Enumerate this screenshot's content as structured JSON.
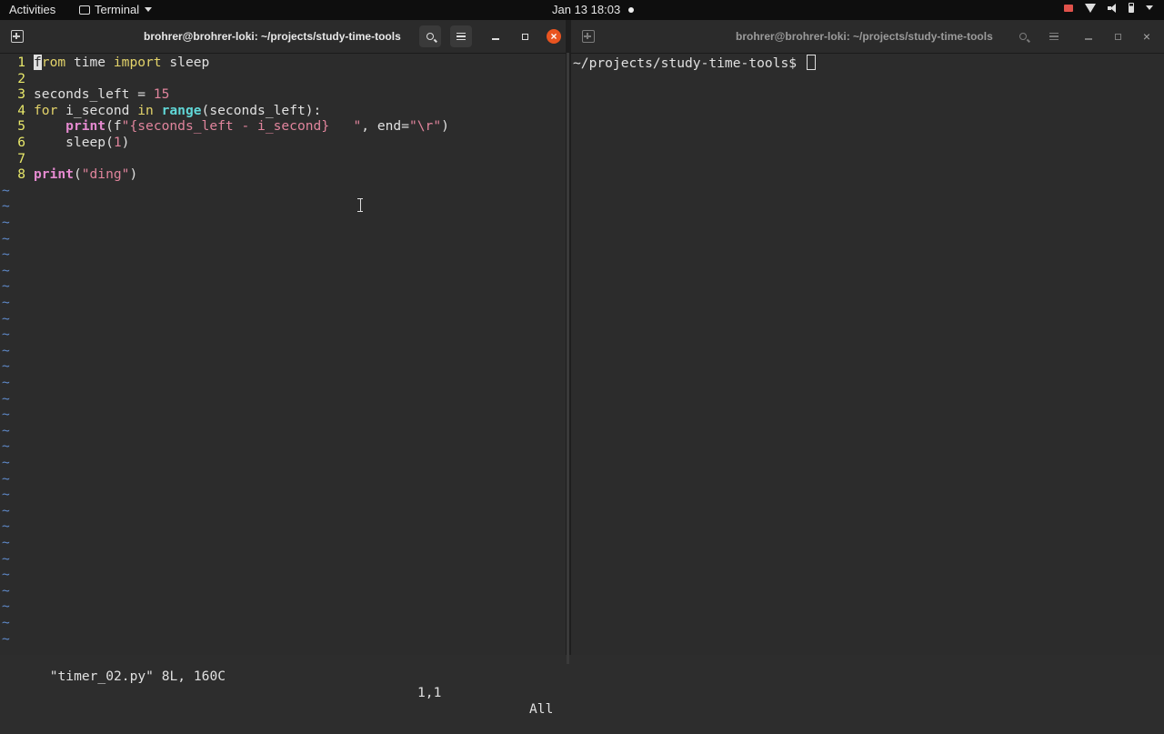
{
  "topbar": {
    "activities": "Activities",
    "app_name": "Terminal",
    "clock": "Jan 13  18:03"
  },
  "left_window": {
    "title": "brohrer@brohrer-loki: ~/projects/study-time-tools",
    "close_glyph": "×"
  },
  "right_window": {
    "title": "brohrer@brohrer-loki: ~/projects/study-time-tools",
    "close_glyph": "×",
    "prompt": "~/projects/study-time-tools$ "
  },
  "editor": {
    "line_numbers": [
      "1",
      "2",
      "3",
      "4",
      "5",
      "6",
      "7",
      "8"
    ],
    "code": {
      "l1_cursor": "f",
      "l1_kw": "rom",
      "l1_mid": " time ",
      "l1_kw2": "import",
      "l1_end": " sleep",
      "l3_a": "seconds_left = ",
      "l3_num": "15",
      "l4_for": "for",
      "l4_a": " i_second ",
      "l4_in": "in",
      "l4_sp": " ",
      "l4_range": "range",
      "l4_end": "(seconds_left):",
      "l5_indent": "    ",
      "l5_print": "print",
      "l5_a": "(f",
      "l5_str": "\"{seconds_left - i_second}   \"",
      "l5_b": ", end=",
      "l5_str2": "\"\\r\"",
      "l5_c": ")",
      "l6_indent": "    ",
      "l6_a": "sleep(",
      "l6_num": "1",
      "l6_b": ")",
      "l8_print": "print",
      "l8_a": "(",
      "l8_str": "\"ding\"",
      "l8_b": ")"
    },
    "tilde": "~",
    "status_file": "\"timer_02.py\" 8L, 160C",
    "status_pos": "1,1",
    "status_all": "All"
  }
}
